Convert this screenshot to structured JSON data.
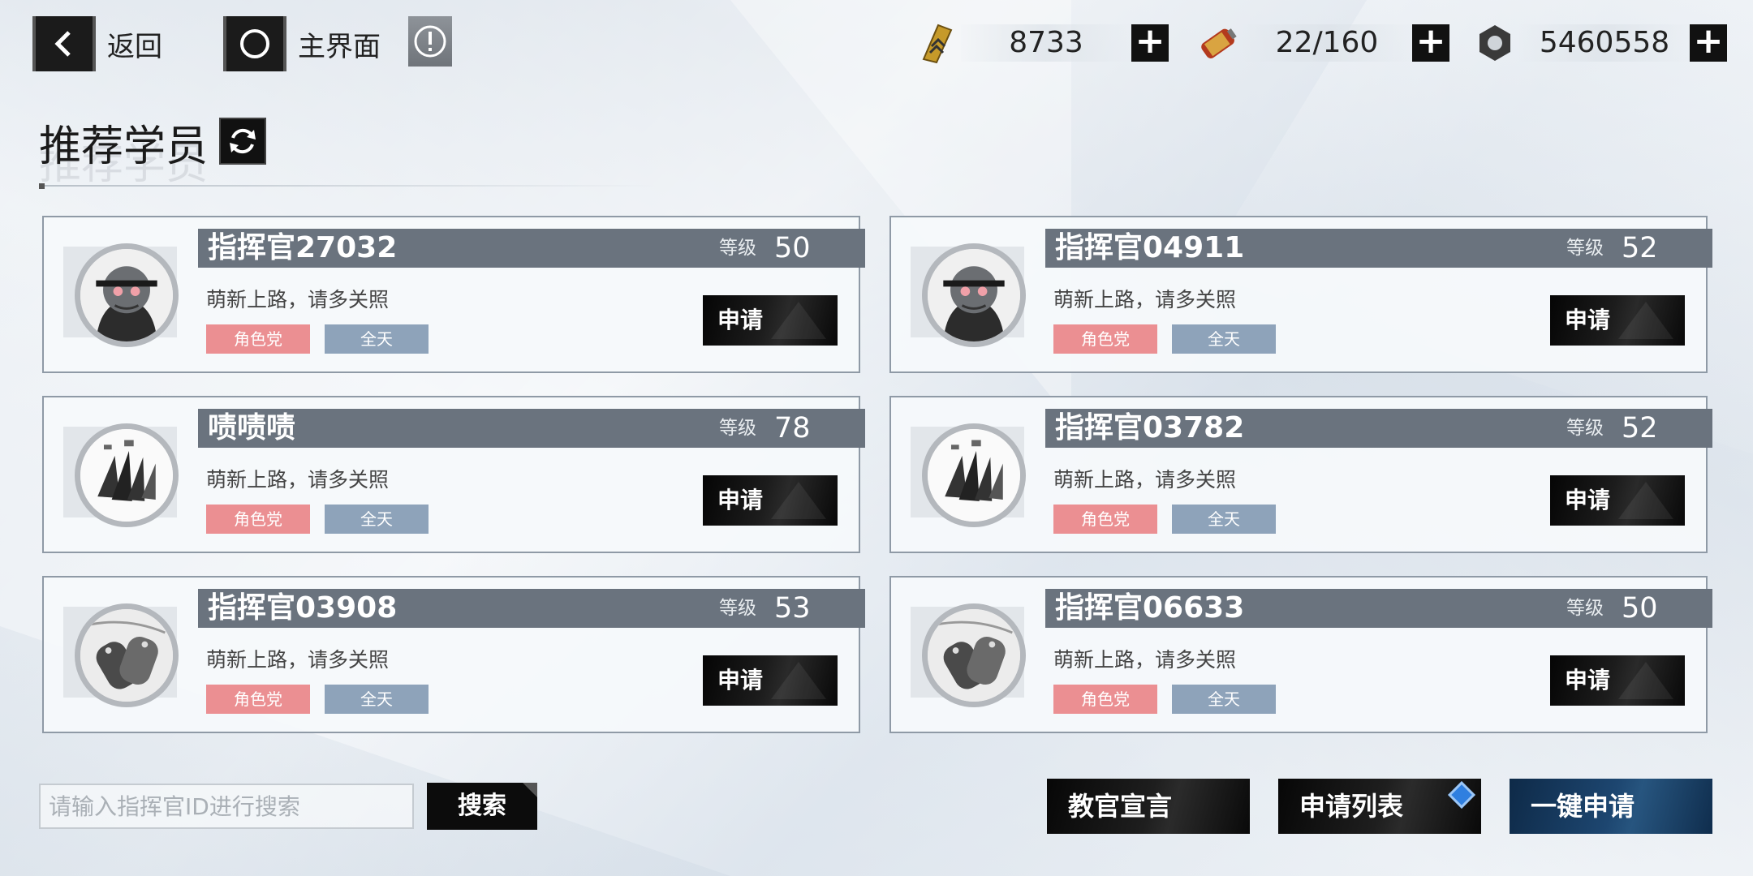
{
  "topbar": {
    "back_label": "返回",
    "home_label": "主界面",
    "resources": [
      {
        "icon": "ticket-icon",
        "value": "8733"
      },
      {
        "icon": "battery-icon",
        "value": "22/160"
      },
      {
        "icon": "gear-nut-icon",
        "value": "5460558"
      }
    ],
    "plus_label": "+"
  },
  "header": {
    "title": "推荐学员"
  },
  "card_common": {
    "level_label": "等级",
    "motto": "萌新上路，请多关照",
    "tag_role": "角色党",
    "tag_time": "全天",
    "apply_label": "申请"
  },
  "cards": [
    {
      "name": "指挥官27032",
      "level": "50",
      "avatar": "doll-avatar-icon"
    },
    {
      "name": "指挥官04911",
      "level": "52",
      "avatar": "doll-avatar-icon"
    },
    {
      "name": "啧啧啧",
      "level": "78",
      "avatar": "griffin-logo-avatar-icon"
    },
    {
      "name": "指挥官03782",
      "level": "52",
      "avatar": "griffin-logo-avatar-icon"
    },
    {
      "name": "指挥官03908",
      "level": "53",
      "avatar": "dogtag-avatar-icon"
    },
    {
      "name": "指挥官06633",
      "level": "50",
      "avatar": "dogtag-avatar-icon"
    }
  ],
  "search": {
    "placeholder": "请输入指挥官ID进行搜索",
    "button": "搜索"
  },
  "actions": {
    "declaration": "教官宣言",
    "apply_list": "申请列表",
    "one_click": "一键申请"
  }
}
